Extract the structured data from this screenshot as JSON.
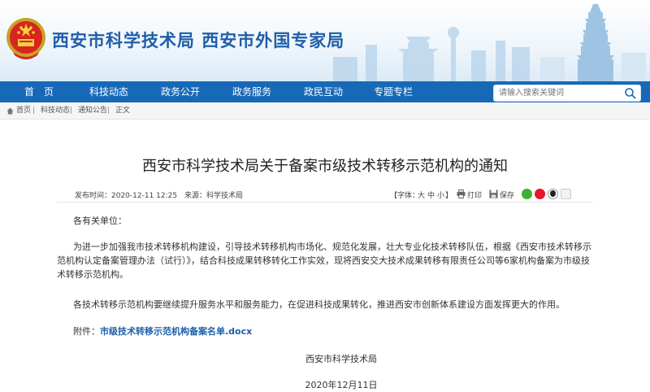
{
  "site": {
    "title": "西安市科学技术局  西安市外国专家局"
  },
  "nav": {
    "items": [
      "首　页",
      "科技动态",
      "政务公开",
      "政务服务",
      "政民互动",
      "专题专栏"
    ],
    "search_placeholder": "请输入搜索关键词"
  },
  "breadcrumb": {
    "items": [
      "首页",
      "科技动态",
      "通知公告",
      "正文"
    ],
    "separator": "|"
  },
  "article": {
    "title": "西安市科学技术局关于备案市级技术转移示范机构的通知",
    "publish_time": "发布时间：2020-12-11 12:25",
    "source": "来源：科学技术局",
    "font_size_label": "【字体：",
    "font_large": "大",
    "font_medium": "中",
    "font_small": "小",
    "font_end": "】",
    "print_label": "打印",
    "save_label": "保存",
    "greeting": "各有关单位：",
    "paragraph1": "为进一步加强我市技术转移机构建设，引导技术转移机构市场化、规范化发展，壮大专业化技术转移队伍，根据《西安市技术转移示范机构认定备案管理办法（试行）》，结合科技成果转移转化工作实效，现将西安交大技术成果转移有限责任公司等6家机构备案为市级技术转移示范机构。",
    "paragraph2": "各技术转移示范机构要继续提升服务水平和服务能力，在促进科技成果转化，推进西安市创新体系建设方面发挥更大的作用。",
    "attachment_label": "附件：",
    "attachment_link": "市级技术转移示范机构备案名单.docx",
    "signature": "西安市科学技术局",
    "date": "2020年12月11日"
  },
  "colors": {
    "nav": "#1769b8",
    "title": "#1f5ea8",
    "link": "#1b5ea8"
  }
}
